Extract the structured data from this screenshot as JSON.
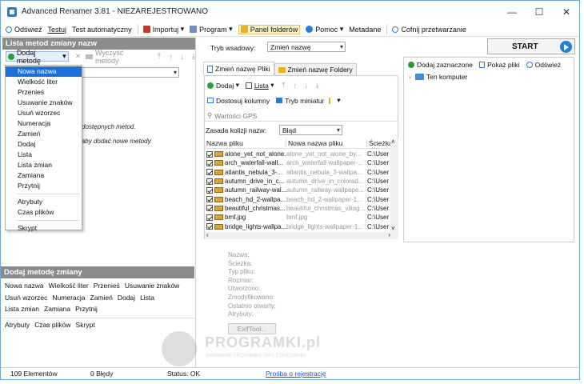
{
  "window": {
    "title": "Advanced Renamer 3.81 - NIEZAREJESTROWANO",
    "minimize": "—",
    "maximize": "☐",
    "close": "✕"
  },
  "toolbar": [
    {
      "label": "Odśwież",
      "color": "#2b7bd6"
    },
    {
      "label": "Testuj",
      "color": ""
    },
    {
      "label": "Test automatyczny",
      "color": ""
    },
    {
      "label": "Importuj",
      "color": "#c0392b",
      "dropdown": "▾"
    },
    {
      "label": "Program",
      "color": "#2b7bd6",
      "dropdown": "▾"
    },
    {
      "label": "Panel folderów",
      "color": "#e6b422"
    },
    {
      "label": "Pomoc",
      "color": "#2b7bd6",
      "dropdown": "▾"
    },
    {
      "label": "Metadane",
      "color": ""
    },
    {
      "label": "Cofnij przetwarzanie",
      "color": "#2b7bd6"
    }
  ],
  "left": {
    "header": "Lista metod zmiany nazw",
    "add_method": "Dodaj metodę",
    "delete_icon": "✕",
    "clear_methods": "Wyczyść metody",
    "arrows": [
      "⤒",
      "↑",
      "↓",
      "⤓"
    ],
    "hint1": "dostępnych metod.",
    "hint2": "\"aby dodać nowe metody.",
    "dropdown_items": [
      "Nowa nazwa",
      "Wielkość liter",
      "Przenieś",
      "Usuwanie znaków",
      "Usuń wzorzec",
      "Numeracja",
      "Zamień",
      "Dodaj",
      "Lista",
      "Lista zmian",
      "Zamiana",
      "Przytnij"
    ],
    "dropdown_items2": [
      "Atrybuty",
      "Czas plików"
    ],
    "dropdown_items3": [
      "Skrypt"
    ]
  },
  "add_panel": {
    "header": "Dodaj metodę zmiany",
    "rows": [
      [
        "Nowa nazwa",
        "Wielkość liter",
        "Przenieś",
        "Usuwanie znaków"
      ],
      [
        "Usuń wzorzec",
        "Numeracja",
        "Zamień",
        "Dodaj",
        "Lista"
      ],
      [
        "Lista zmian",
        "Zamiana",
        "Przytnij"
      ]
    ],
    "rows2": [
      "Atrybuty",
      "Czas plików",
      "Skrypt"
    ]
  },
  "batch": {
    "label": "Tryb wsadowy:",
    "value": "Zmień nazwę"
  },
  "tabs": [
    "Zmień nazwę Pliki",
    "Zmień nazwę Foldery"
  ],
  "list_tools": {
    "add": "Dodaj",
    "list": "Lista",
    "adjust": "Dostosuj kolumny",
    "thumbs": "Tryb miniatur",
    "gps": "Wartości GPS"
  },
  "collision": {
    "label": "Zasada kolizji nazw:",
    "value": "Błąd"
  },
  "columns": [
    "Nazwa pliku",
    "Nowa nazwa pliku",
    "Ścieżka"
  ],
  "files": [
    [
      "alone_yet_not_alone...",
      "alone_yet_not_alone_by...",
      "C:\\User"
    ],
    [
      "arch_waterfall-wall...",
      "arch_waterfall-wallpaper-...",
      "C:\\User"
    ],
    [
      "atlantis_nebula_3-...",
      "atlantis_nebula_3-wallpa...",
      "C:\\User"
    ],
    [
      "autumn_drive_in_c...",
      "autumn_drive_in_colorad...",
      "C:\\User"
    ],
    [
      "autumn_railway-wal...",
      "autumn_railway-wallpape...",
      "C:\\User"
    ],
    [
      "beach_hd_2-wallpa...",
      "beach_hd_2-wallpaper-1...",
      "C:\\User"
    ],
    [
      "beautiful_christmas...",
      "beautiful_christmas_villag...",
      "C:\\User"
    ],
    [
      "bmf.jpg",
      "bmf.jpg",
      "C:\\User"
    ],
    [
      "bridge_lights-wallpa...",
      "bridge_lights-wallpaper-1...",
      "C:\\User"
    ]
  ],
  "details": [
    "Nazwa:",
    "Ścieżka:",
    "Typ pliku:",
    "Rozmiar:",
    "Utworzono:",
    "Zmodyfikowano:",
    "Ostatnio otwarty:",
    "Atrybuty:"
  ],
  "exif": "ExifTool...",
  "start": "START",
  "right": {
    "add_selected": "Dodaj zaznaczone",
    "show_files": "Pokaż pliki",
    "refresh": "Odśwież",
    "tree_root": "Ten komputer"
  },
  "status": {
    "count": "109 Elementów",
    "errors": "0 Błędy",
    "status": "Status: OK",
    "register": "Prośba o rejestrację"
  },
  "watermark": {
    "brand": "PROGRAMKI.pl",
    "tagline": "DARMOWE PROGRAMY, GRY, STEROWNIKI"
  }
}
